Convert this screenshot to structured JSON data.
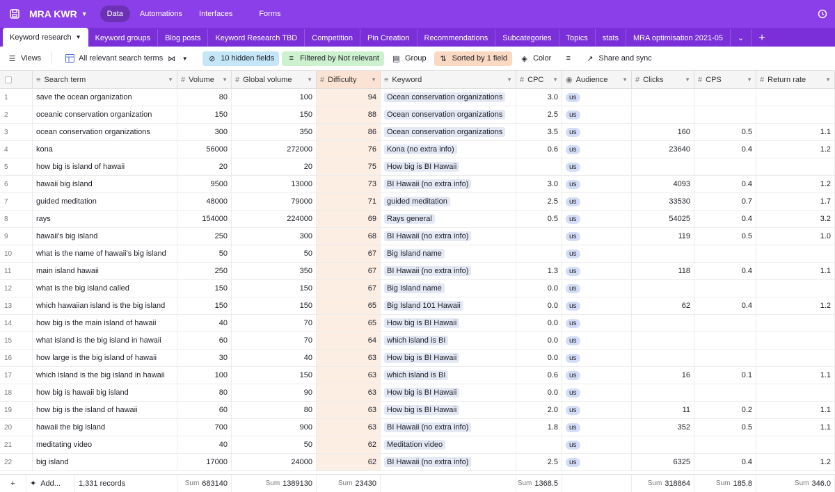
{
  "app": {
    "base_name": "MRA KWR",
    "nav": [
      "Data",
      "Automations",
      "Interfaces",
      "Forms"
    ]
  },
  "tabs": {
    "active": "Keyword research",
    "items": [
      "Keyword groups",
      "Blog posts",
      "Keyword Research TBD",
      "Competition",
      "Pin Creation",
      "Recommendations",
      "Subcategories",
      "Topics",
      "stats",
      "MRA optimisation 2021-05"
    ]
  },
  "toolbar": {
    "views": "Views",
    "view_name": "All relevant search terms",
    "hidden_fields": "10 hidden fields",
    "filtered": "Filtered by Not relevant",
    "group": "Group",
    "sorted": "Sorted by 1 field",
    "color": "Color",
    "share": "Share and sync"
  },
  "columns": [
    "Search term",
    "Volume",
    "Global volume",
    "Difficulty",
    "Keyword",
    "CPC",
    "Audience",
    "Clicks",
    "CPS",
    "Return rate"
  ],
  "rows": [
    {
      "n": "1",
      "term": "save the ocean organization",
      "vol": "80",
      "gvol": "100",
      "diff": "94",
      "kw": "Ocean conservation organizations",
      "cpc": "3.0",
      "aud": "us",
      "clicks": "",
      "cps": "",
      "rr": ""
    },
    {
      "n": "2",
      "term": "oceanic conservation organization",
      "vol": "150",
      "gvol": "150",
      "diff": "88",
      "kw": "Ocean conservation organizations",
      "cpc": "2.5",
      "aud": "us",
      "clicks": "",
      "cps": "",
      "rr": ""
    },
    {
      "n": "3",
      "term": "ocean conservation organizations",
      "vol": "300",
      "gvol": "350",
      "diff": "86",
      "kw": "Ocean conservation organizations",
      "cpc": "3.5",
      "aud": "us",
      "clicks": "160",
      "cps": "0.5",
      "rr": "1.1"
    },
    {
      "n": "4",
      "term": "kona",
      "vol": "56000",
      "gvol": "272000",
      "diff": "76",
      "kw": "Kona (no extra info)",
      "cpc": "0.6",
      "aud": "us",
      "clicks": "23640",
      "cps": "0.4",
      "rr": "1.2"
    },
    {
      "n": "5",
      "term": "how big is island of hawaii",
      "vol": "20",
      "gvol": "20",
      "diff": "75",
      "kw": "How big is BI Hawaii",
      "cpc": "",
      "aud": "us",
      "clicks": "",
      "cps": "",
      "rr": ""
    },
    {
      "n": "6",
      "term": "hawaii big island",
      "vol": "9500",
      "gvol": "13000",
      "diff": "73",
      "kw": "BI Hawaii (no extra info)",
      "cpc": "3.0",
      "aud": "us",
      "clicks": "4093",
      "cps": "0.4",
      "rr": "1.2"
    },
    {
      "n": "7",
      "term": "guided meditation",
      "vol": "48000",
      "gvol": "79000",
      "diff": "71",
      "kw": "guided meditation",
      "cpc": "2.5",
      "aud": "us",
      "clicks": "33530",
      "cps": "0.7",
      "rr": "1.7"
    },
    {
      "n": "8",
      "term": "rays",
      "vol": "154000",
      "gvol": "224000",
      "diff": "69",
      "kw": "Rays general",
      "cpc": "0.5",
      "aud": "us",
      "clicks": "54025",
      "cps": "0.4",
      "rr": "3.2"
    },
    {
      "n": "9",
      "term": "hawaii's big island",
      "vol": "250",
      "gvol": "300",
      "diff": "68",
      "kw": "BI Hawaii (no extra info)",
      "cpc": "",
      "aud": "us",
      "clicks": "119",
      "cps": "0.5",
      "rr": "1.0"
    },
    {
      "n": "10",
      "term": "what is the name of hawaii's big island",
      "vol": "50",
      "gvol": "50",
      "diff": "67",
      "kw": "Big Island name",
      "cpc": "",
      "aud": "us",
      "clicks": "",
      "cps": "",
      "rr": ""
    },
    {
      "n": "11",
      "term": "main island hawaii",
      "vol": "250",
      "gvol": "350",
      "diff": "67",
      "kw": "BI Hawaii (no extra info)",
      "cpc": "1.3",
      "aud": "us",
      "clicks": "118",
      "cps": "0.4",
      "rr": "1.1"
    },
    {
      "n": "12",
      "term": "what is the big island called",
      "vol": "150",
      "gvol": "150",
      "diff": "67",
      "kw": "Big Island name",
      "cpc": "0.0",
      "aud": "us",
      "clicks": "",
      "cps": "",
      "rr": ""
    },
    {
      "n": "13",
      "term": "which hawaiian island is the big island",
      "vol": "150",
      "gvol": "150",
      "diff": "65",
      "kw": "Big Island 101 Hawaii",
      "cpc": "0.0",
      "aud": "us",
      "clicks": "62",
      "cps": "0.4",
      "rr": "1.2"
    },
    {
      "n": "14",
      "term": "how big is the main island of hawaii",
      "vol": "40",
      "gvol": "70",
      "diff": "65",
      "kw": "How big is BI Hawaii",
      "cpc": "0.0",
      "aud": "us",
      "clicks": "",
      "cps": "",
      "rr": ""
    },
    {
      "n": "15",
      "term": "what island is the big island in hawaii",
      "vol": "60",
      "gvol": "70",
      "diff": "64",
      "kw": "which island is BI",
      "cpc": "0.0",
      "aud": "us",
      "clicks": "",
      "cps": "",
      "rr": ""
    },
    {
      "n": "16",
      "term": "how large is the big island of hawaii",
      "vol": "30",
      "gvol": "40",
      "diff": "63",
      "kw": "How big is BI Hawaii",
      "cpc": "0.0",
      "aud": "us",
      "clicks": "",
      "cps": "",
      "rr": ""
    },
    {
      "n": "17",
      "term": "which island is the big island in hawaii",
      "vol": "100",
      "gvol": "150",
      "diff": "63",
      "kw": "which island is BI",
      "cpc": "0.6",
      "aud": "us",
      "clicks": "16",
      "cps": "0.1",
      "rr": "1.1"
    },
    {
      "n": "18",
      "term": "how big is hawaii big island",
      "vol": "80",
      "gvol": "90",
      "diff": "63",
      "kw": "How big is BI Hawaii",
      "cpc": "0.0",
      "aud": "us",
      "clicks": "",
      "cps": "",
      "rr": ""
    },
    {
      "n": "19",
      "term": "how big is the island of hawaii",
      "vol": "60",
      "gvol": "80",
      "diff": "63",
      "kw": "How big is BI Hawaii",
      "cpc": "2.0",
      "aud": "us",
      "clicks": "11",
      "cps": "0.2",
      "rr": "1.1"
    },
    {
      "n": "20",
      "term": "hawaii the big island",
      "vol": "700",
      "gvol": "900",
      "diff": "63",
      "kw": "BI Hawaii (no extra info)",
      "cpc": "1.8",
      "aud": "us",
      "clicks": "352",
      "cps": "0.5",
      "rr": "1.1"
    },
    {
      "n": "21",
      "term": "meditating video",
      "vol": "40",
      "gvol": "50",
      "diff": "62",
      "kw": "Meditation video",
      "cpc": "",
      "aud": "us",
      "clicks": "",
      "cps": "",
      "rr": ""
    },
    {
      "n": "22",
      "term": "big island",
      "vol": "17000",
      "gvol": "24000",
      "diff": "62",
      "kw": "BI Hawaii (no extra info)",
      "cpc": "2.5",
      "aud": "us",
      "clicks": "6325",
      "cps": "0.4",
      "rr": "1.2"
    }
  ],
  "footer": {
    "add_more": "Add...",
    "records": "1,331 records",
    "sum_label": "Sum",
    "sum_volume": "683140",
    "sum_global_volume": "1389130",
    "sum_difficulty": "23430",
    "sum_cpc": "1368.5",
    "sum_clicks": "318864",
    "sum_cps": "185.8",
    "sum_return_rate": "346.0"
  }
}
